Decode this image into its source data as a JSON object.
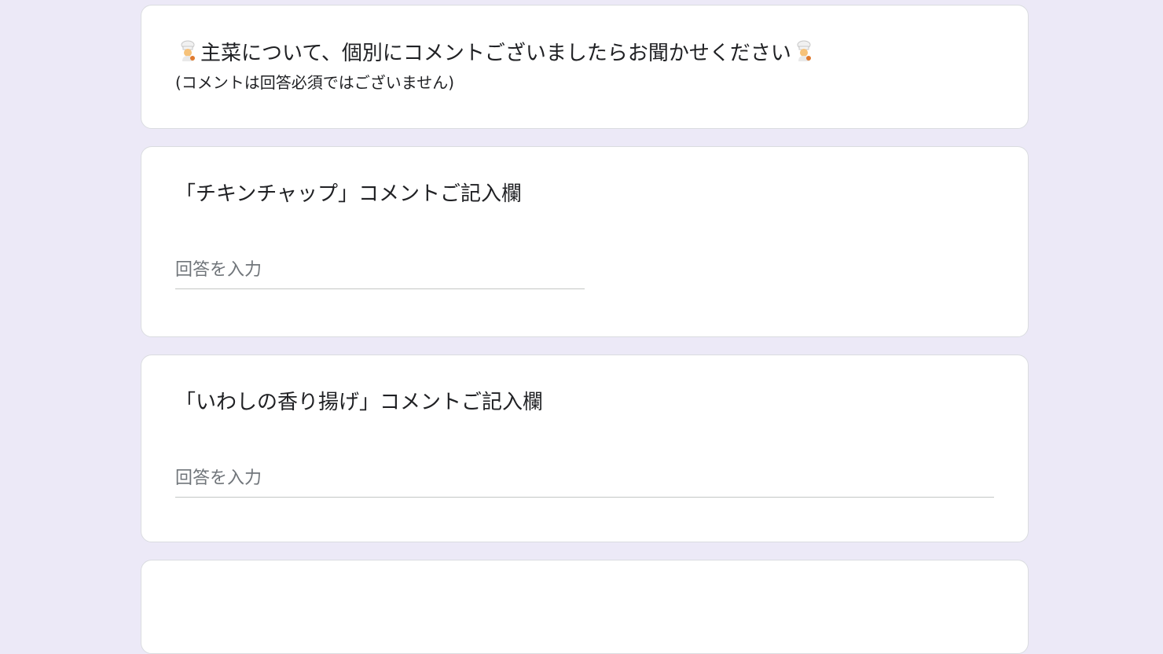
{
  "section": {
    "title": "主菜について、個別にコメントございましたらお聞かせください",
    "title_emoji": "chef-emoji-icon",
    "description": "(コメントは回答必須ではございません)"
  },
  "questions": [
    {
      "title": "「チキンチャップ」コメントご記入欄",
      "placeholder": "回答を入力",
      "value": ""
    },
    {
      "title": "「いわしの香り揚げ」コメントご記入欄",
      "placeholder": "回答を入力",
      "value": ""
    }
  ],
  "colors": {
    "background": "#ece9f7",
    "card": "#ffffff",
    "border": "#dadce0",
    "text": "#202124",
    "placeholder": "#70757a"
  }
}
